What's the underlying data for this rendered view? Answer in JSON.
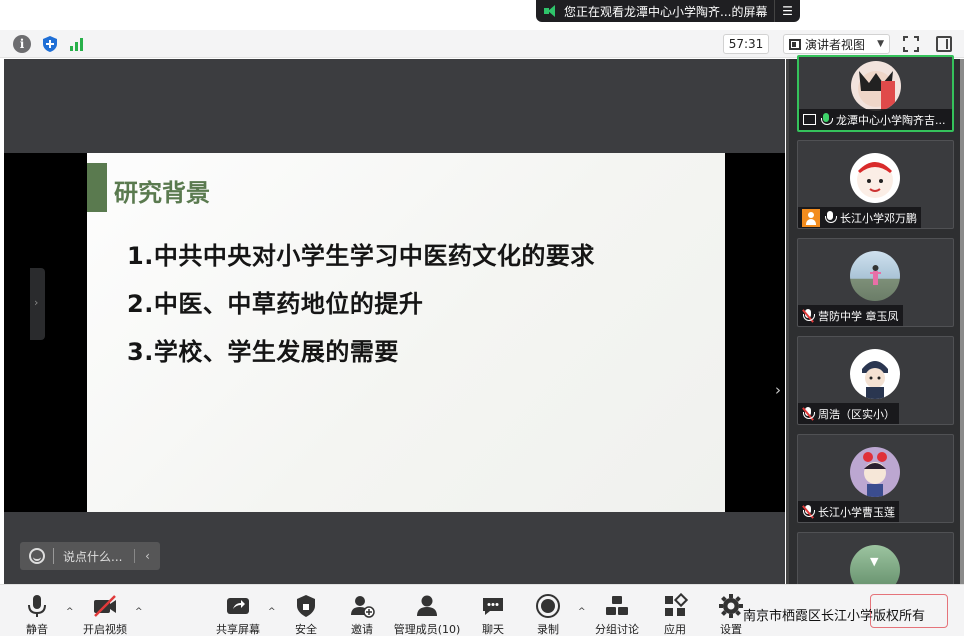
{
  "share_banner": {
    "text": "您正在观看龙潭中心小学陶齐...的屏幕",
    "menu_icon": "menu-icon"
  },
  "topbar": {
    "timer": "57:31",
    "view_label": "演讲者视图"
  },
  "slide": {
    "title": "研究背景",
    "points": [
      "1.中共中央对小学生学习中医药文化的要求",
      "2.中医、中草药地位的提升",
      "3.学校、学生发展的需要"
    ]
  },
  "chat": {
    "placeholder": "说点什么..."
  },
  "participants": [
    {
      "name": "龙潭中心小学陶齐吉...",
      "mic": "active",
      "sharing": true
    },
    {
      "name": "长江小学邓万鹏",
      "mic": "on",
      "host": true
    },
    {
      "name": "营防中学 章玉凤",
      "mic": "muted"
    },
    {
      "name": "周浩（区实小）",
      "mic": "muted"
    },
    {
      "name": "长江小学曹玉莲",
      "mic": "muted"
    }
  ],
  "toolbar": {
    "mute": "静音",
    "video": "开启视频",
    "share": "共享屏幕",
    "security": "安全",
    "invite": "邀请",
    "members": "管理成员(10)",
    "chat": "聊天",
    "record": "录制",
    "breakout": "分组讨论",
    "apps": "应用",
    "settings": "设置"
  },
  "footer": "南京市栖霞区长江小学版权所有",
  "colors": {
    "accent_green": "#35c25b",
    "slide_green": "#5a7a4f",
    "stage_bg": "#3c3d40"
  }
}
